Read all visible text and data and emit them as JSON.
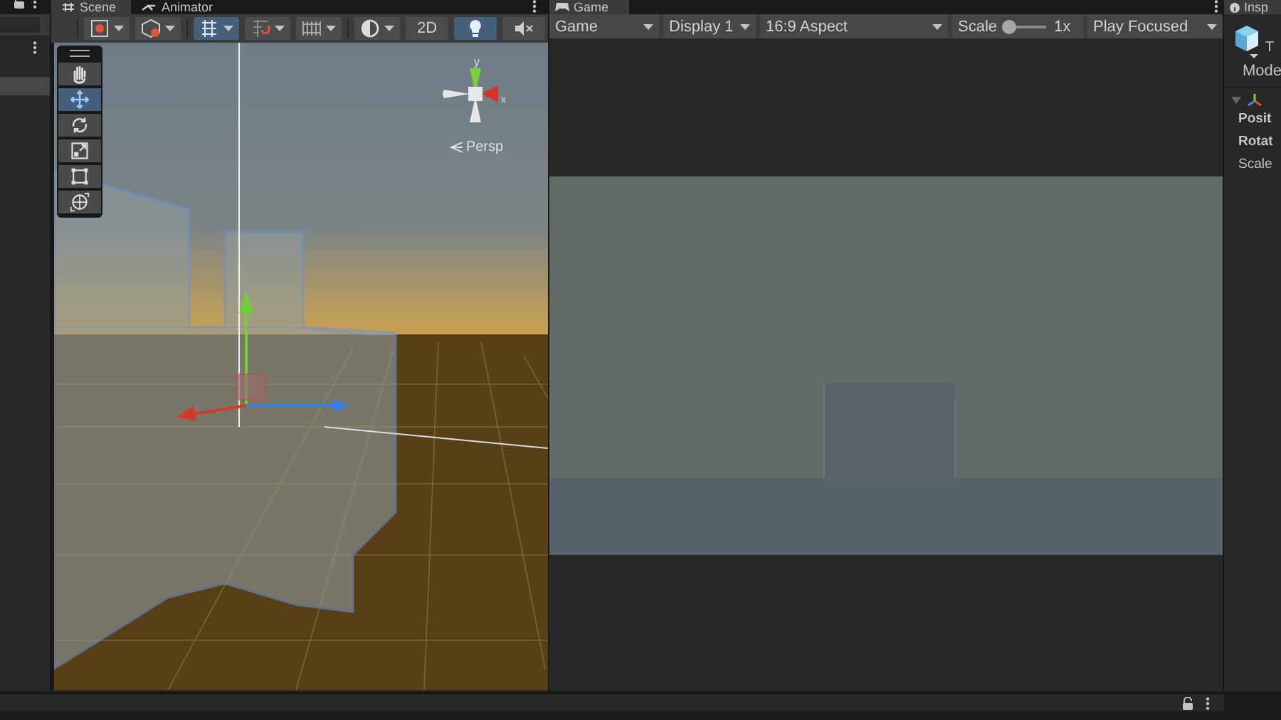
{
  "scene_panel": {
    "tabs": [
      {
        "label": "Scene",
        "selected": true
      },
      {
        "label": "Animator",
        "selected": false
      }
    ],
    "toolbar": [
      {
        "kind": "draw-mode",
        "selected": false
      },
      {
        "kind": "view-options",
        "selected": false
      },
      {
        "kind": "grid-snap",
        "selected": true
      },
      {
        "kind": "snap-increment",
        "selected": false
      },
      {
        "kind": "grid-toggle",
        "selected": false
      },
      {
        "kind": "overlays",
        "selected": false
      },
      {
        "kind": "text",
        "label": "2D",
        "selected": false
      },
      {
        "kind": "lighting",
        "selected": true
      },
      {
        "kind": "audio",
        "selected": false
      }
    ],
    "tools": [
      {
        "kind": "hand",
        "selected": false
      },
      {
        "kind": "move",
        "selected": true
      },
      {
        "kind": "rotate",
        "selected": false
      },
      {
        "kind": "scale",
        "selected": false
      },
      {
        "kind": "rect",
        "selected": false
      },
      {
        "kind": "transform",
        "selected": false
      }
    ],
    "gizmo": {
      "y_label": "y",
      "x_label": "x",
      "projection": "Persp"
    }
  },
  "game_panel": {
    "tab": "Game",
    "mode": "Game",
    "display": "Display 1",
    "aspect": "16:9 Aspect",
    "scale_label": "Scale",
    "scale": {
      "level": 0.1
    },
    "scale_reading": "1x",
    "play_mode": "Play Focused"
  },
  "inspector": {
    "tab": "Insp",
    "name": "T",
    "fields": [
      "Mode"
    ],
    "transform_rows": [
      {
        "label": "Posit",
        "bold": true
      },
      {
        "label": "Rotat",
        "bold": true
      },
      {
        "label": "Scale",
        "bold": false
      }
    ]
  }
}
